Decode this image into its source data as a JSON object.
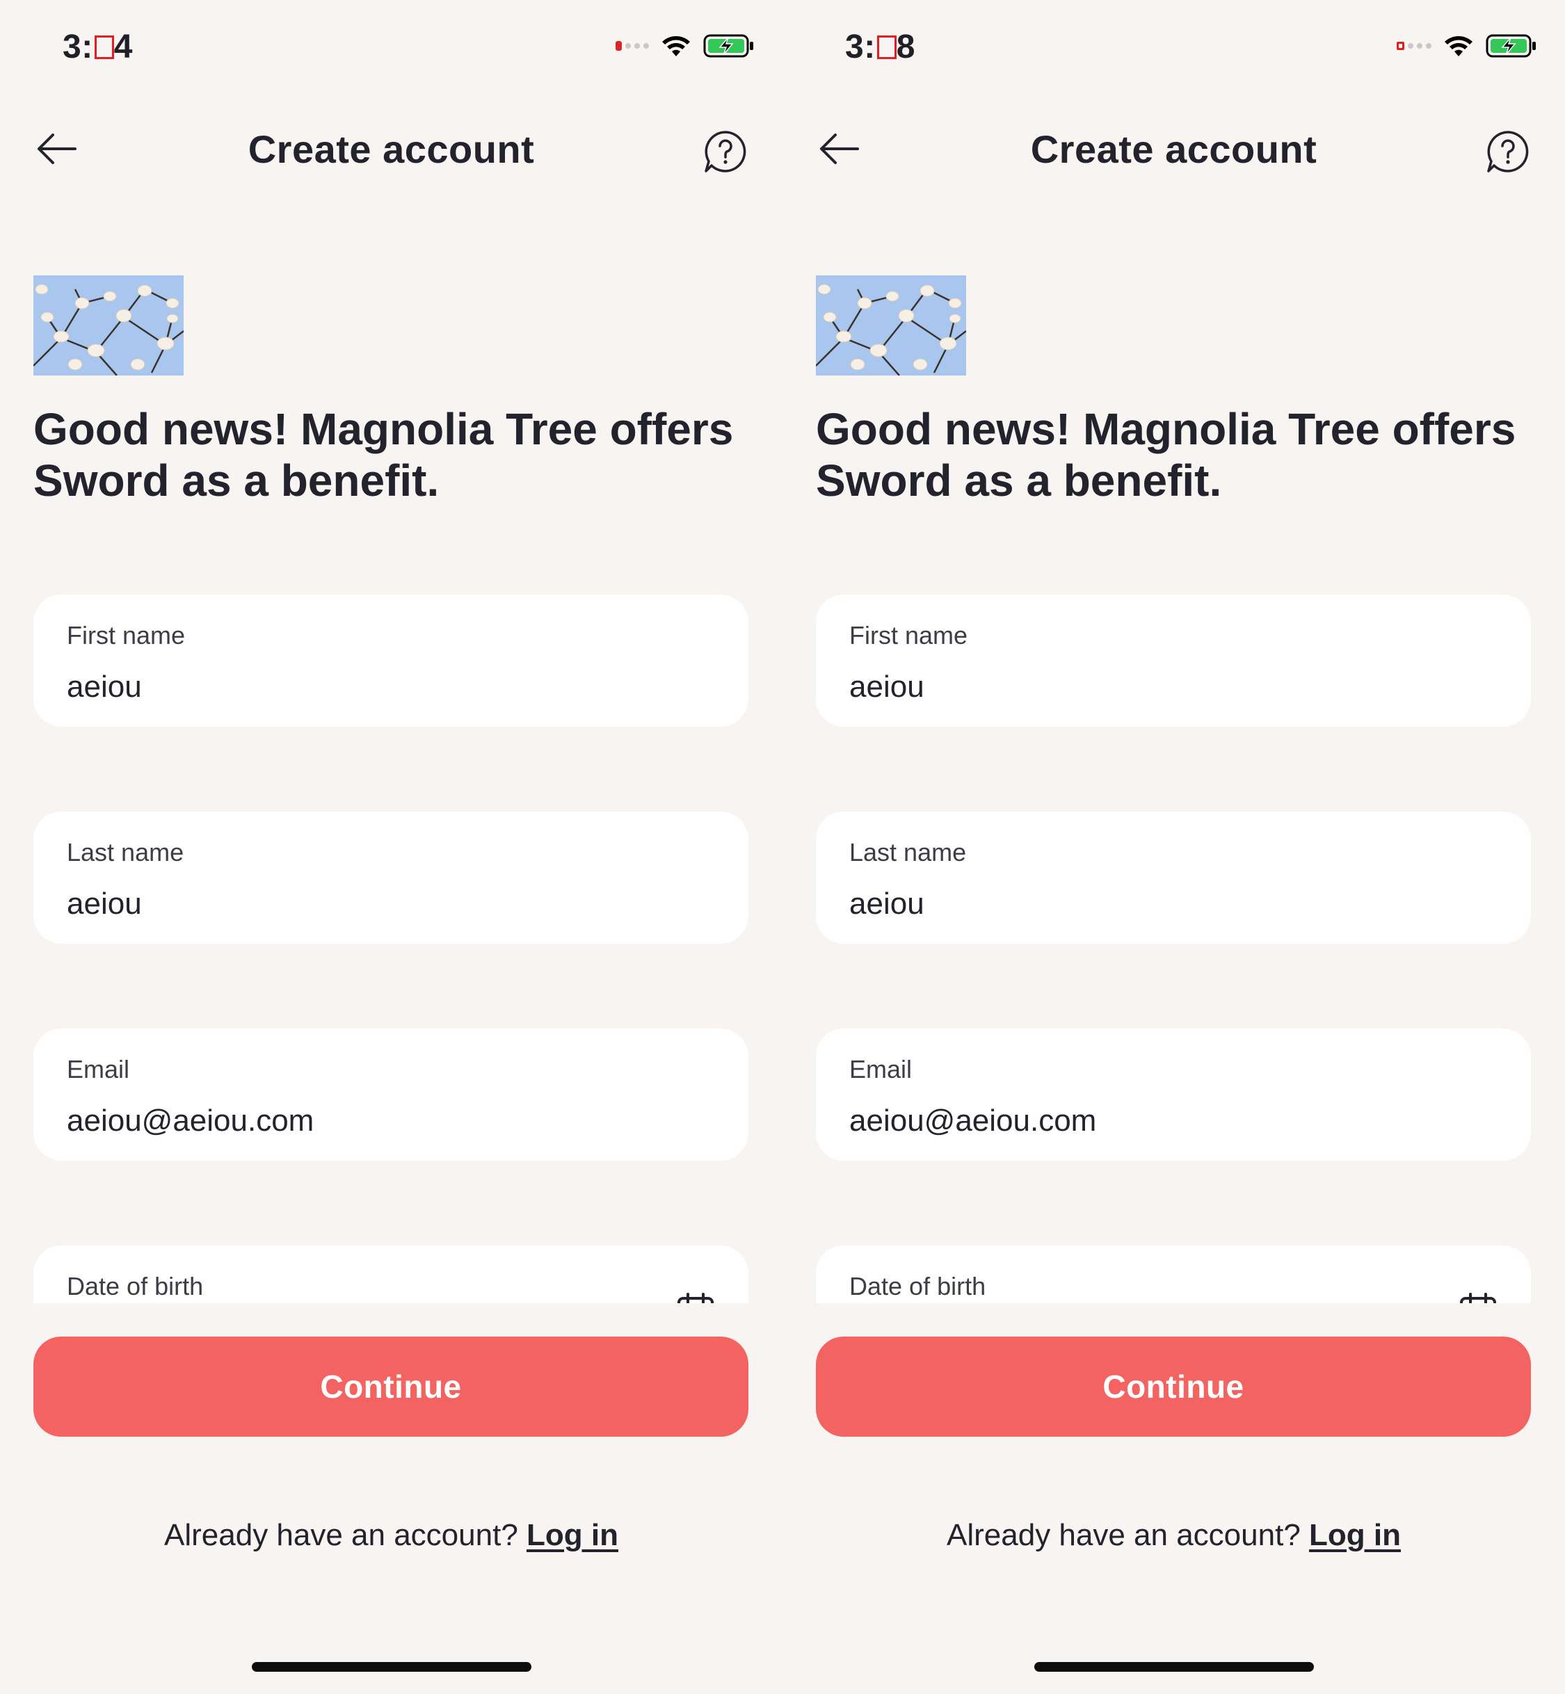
{
  "screens": [
    {
      "status": {
        "time_prefix": "3:",
        "time_digit": "4"
      },
      "header": {
        "title": "Create account"
      },
      "headline": "Good news! Magnolia Tree offers Sword as a benefit.",
      "fields": {
        "first_name": {
          "label": "First name",
          "value": "aeiou"
        },
        "last_name": {
          "label": "Last name",
          "value": "aeiou"
        },
        "email": {
          "label": "Email",
          "value": "aeiou@aeiou.com"
        },
        "dob": {
          "label": "Date of birth"
        }
      },
      "continue_label": "Continue",
      "login": {
        "prompt": "Already have an account?",
        "link": "Log in"
      }
    },
    {
      "status": {
        "time_prefix": "3:",
        "time_digit": "8"
      },
      "header": {
        "title": "Create account"
      },
      "headline": "Good news! Magnolia Tree offers Sword as a benefit.",
      "fields": {
        "first_name": {
          "label": "First name",
          "value": "aeiou"
        },
        "last_name": {
          "label": "Last name",
          "value": "aeiou"
        },
        "email": {
          "label": "Email",
          "value": "aeiou@aeiou.com"
        },
        "dob": {
          "label": "Date of birth"
        }
      },
      "continue_label": "Continue",
      "login": {
        "prompt": "Already have an account?",
        "link": "Log in"
      }
    }
  ],
  "colors": {
    "background": "#f7f4f1",
    "accent": "#f26361",
    "field_bg": "#ffffff",
    "text": "#23232d",
    "battery": "#34c759"
  },
  "icons": [
    "back-arrow-icon",
    "help-chat-icon",
    "calendar-icon",
    "wifi-icon",
    "battery-charging-icon",
    "signal-icon"
  ]
}
